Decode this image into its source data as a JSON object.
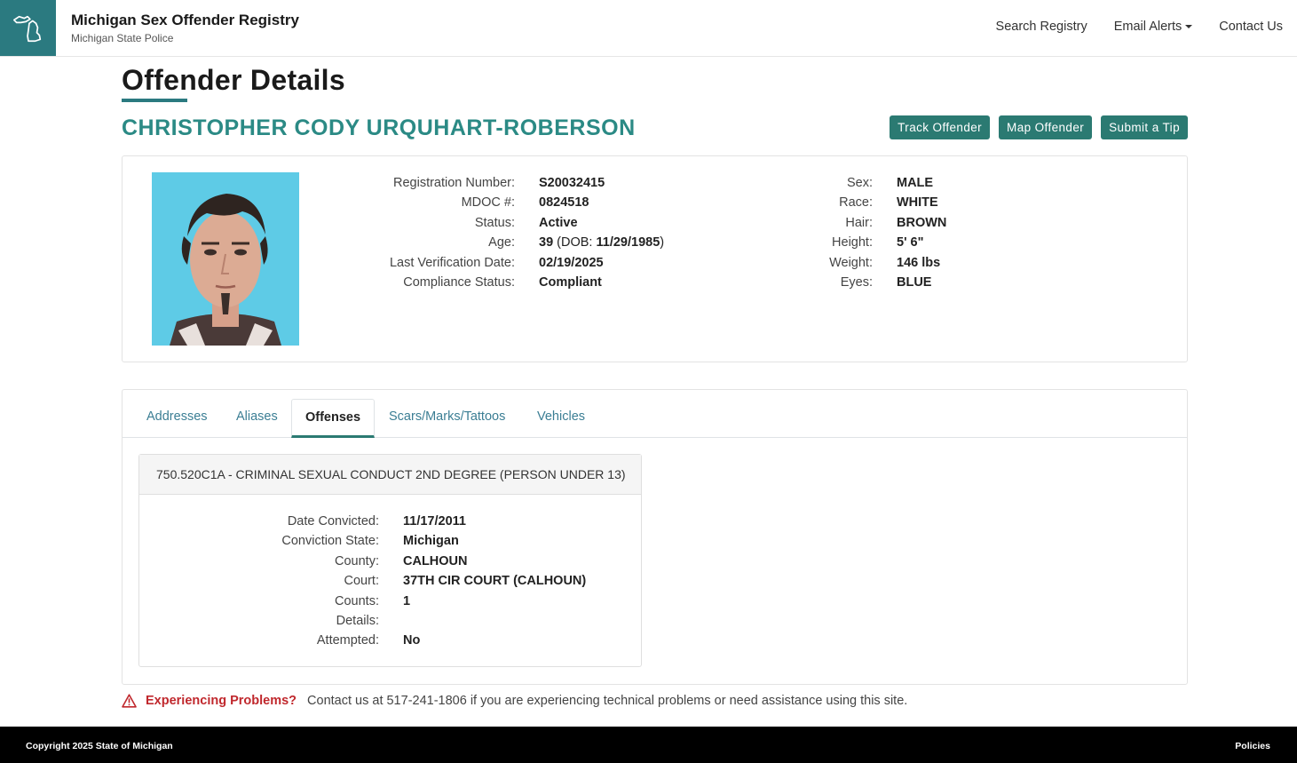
{
  "header": {
    "title": "Michigan Sex Offender Registry",
    "subtitle": "Michigan State Police",
    "logo_icon": "michigan-map-icon",
    "nav": {
      "search": "Search Registry",
      "email": "Email Alerts",
      "contact": "Contact Us"
    }
  },
  "page": {
    "title": "Offender Details"
  },
  "offender": {
    "name": "CHRISTOPHER CODY URQUHART-ROBERSON",
    "actions": {
      "track": "Track Offender",
      "map": "Map Offender",
      "tip": "Submit a Tip"
    },
    "left_fields": [
      {
        "label": "Registration Number:",
        "value": "S20032415"
      },
      {
        "label": "MDOC #:",
        "value": "0824518"
      },
      {
        "label": "Status:",
        "value": "Active"
      },
      {
        "label": "Age:",
        "value": "39",
        "dob_prefix": " (DOB: ",
        "dob": "11/29/1985",
        "dob_suffix": ")"
      },
      {
        "label": "Last Verification Date:",
        "value": "02/19/2025"
      },
      {
        "label": "Compliance Status:",
        "value": "Compliant"
      }
    ],
    "right_fields": [
      {
        "label": "Sex:",
        "value": "MALE"
      },
      {
        "label": "Race:",
        "value": "WHITE"
      },
      {
        "label": "Hair:",
        "value": "BROWN"
      },
      {
        "label": "Height:",
        "value": "5' 6\""
      },
      {
        "label": "Weight:",
        "value": "146 lbs"
      },
      {
        "label": "Eyes:",
        "value": "BLUE"
      }
    ]
  },
  "tabs": {
    "addresses": "Addresses",
    "aliases": "Aliases",
    "offenses": "Offenses",
    "scars": "Scars/Marks/Tattoos",
    "vehicles": "Vehicles",
    "active": "offenses"
  },
  "offense": {
    "title": "750.520C1A - CRIMINAL SEXUAL CONDUCT 2ND DEGREE (PERSON UNDER 13)",
    "fields": [
      {
        "label": "Date Convicted:",
        "value": "11/17/2011"
      },
      {
        "label": "Conviction State:",
        "value": "Michigan"
      },
      {
        "label": "County:",
        "value": "CALHOUN"
      },
      {
        "label": "Court:",
        "value": "37TH CIR COURT (CALHOUN)"
      },
      {
        "label": "Counts:",
        "value": "1"
      },
      {
        "label": "Details:",
        "value": ""
      },
      {
        "label": "Attempted:",
        "value": "No"
      }
    ]
  },
  "problems": {
    "icon": "warning-icon",
    "label": "Experiencing Problems?",
    "text": "Contact us at 517-241-1806 if you are experiencing technical problems or need assistance using this site."
  },
  "footer": {
    "copyright": "Copyright 2025 State of Michigan",
    "policies": "Policies"
  },
  "colors": {
    "brand": "#2b7a80",
    "accent": "#2b8a85",
    "button": "#2b7a72",
    "link": "#3b7e94",
    "warning": "#c0282d"
  }
}
